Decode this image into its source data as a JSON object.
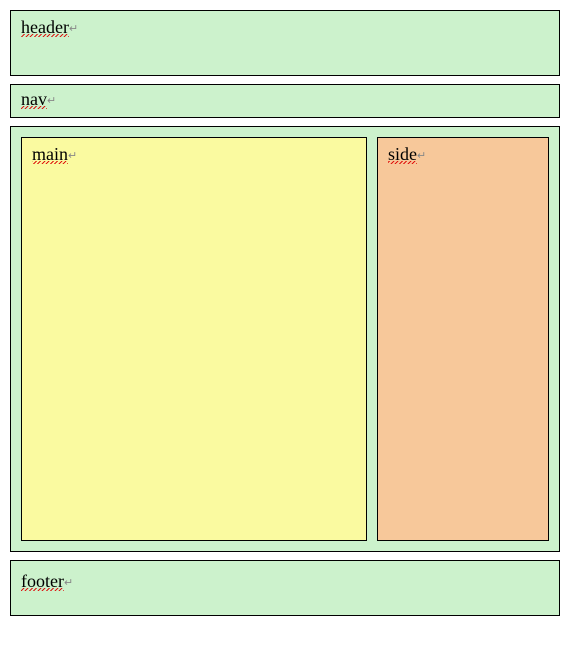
{
  "header": {
    "label": "header"
  },
  "nav": {
    "label": "nav"
  },
  "main": {
    "label": "main"
  },
  "side": {
    "label": "side"
  },
  "footer": {
    "label": "footer"
  },
  "return_glyph": "↵"
}
